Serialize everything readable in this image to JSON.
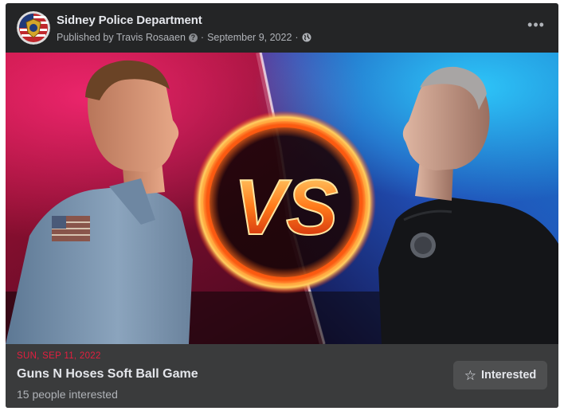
{
  "post": {
    "page_name": "Sidney Police Department",
    "published_by": "Published by Travis Rosaaen",
    "date": "September 9, 2022",
    "sep": "·",
    "info_glyph": "?",
    "more_label": "•••"
  },
  "banner": {
    "vs_text": "VS"
  },
  "event": {
    "date": "SUN, SEP 11, 2022",
    "title": "Guns N Hoses Soft Ball Game",
    "interested_count": "15 people interested",
    "button_label": "Interested",
    "star_icon": "☆"
  },
  "colors": {
    "card_bg": "#242526",
    "footer_bg": "#3a3b3c",
    "date_red": "#e41e3f",
    "text_primary": "#e4e6eb",
    "text_secondary": "#b0b3b8"
  }
}
